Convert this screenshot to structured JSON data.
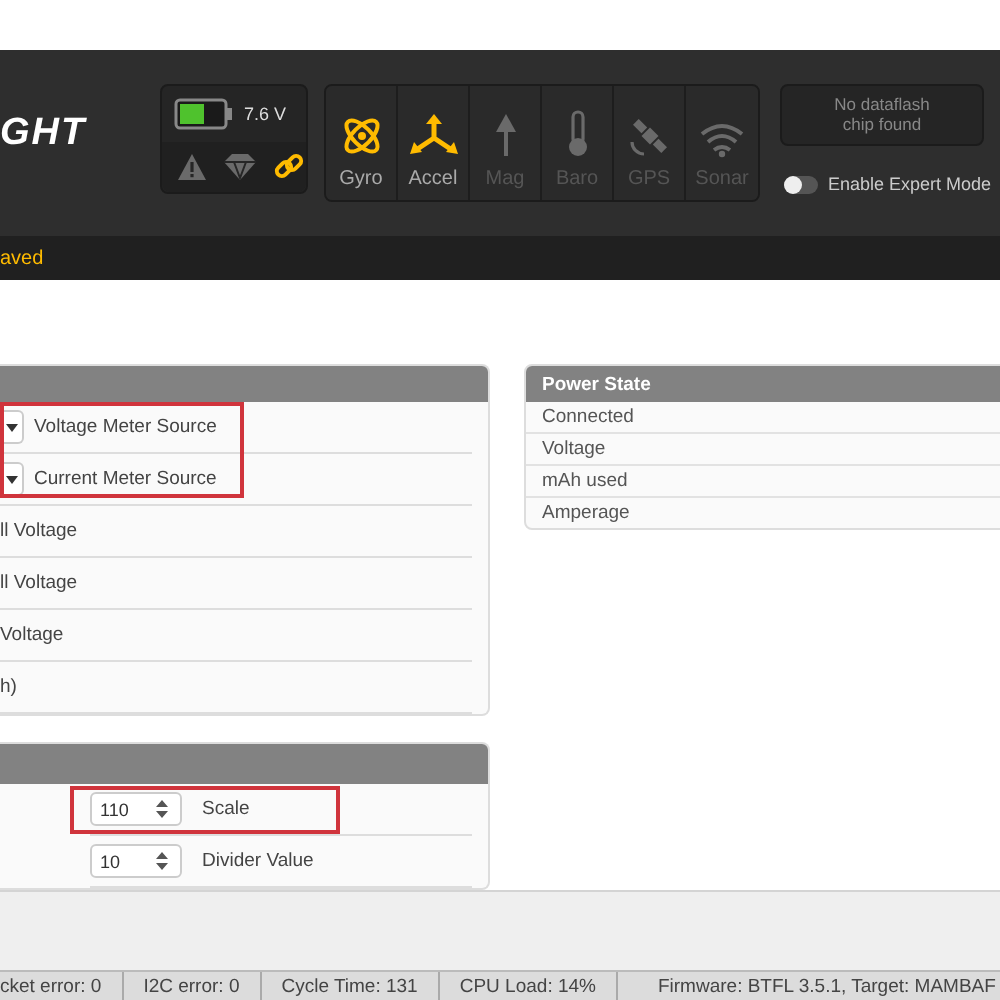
{
  "header": {
    "logo": "GHT",
    "battery": {
      "reading": "7.6 V"
    },
    "indicators": [
      {
        "kind": "warning",
        "on": false
      },
      {
        "kind": "failsafe",
        "on": false
      },
      {
        "kind": "link",
        "on": true
      }
    ],
    "sensors": [
      {
        "kind": "gyro",
        "label": "Gyro",
        "on": true
      },
      {
        "kind": "accel",
        "label": "Accel",
        "on": true
      },
      {
        "kind": "mag",
        "label": "Mag",
        "on": false
      },
      {
        "kind": "baro",
        "label": "Baro",
        "on": false
      },
      {
        "kind": "gps",
        "label": "GPS",
        "on": false
      },
      {
        "kind": "sonar",
        "label": "Sonar",
        "on": false
      }
    ],
    "dataflash_button": "No dataflash chip found",
    "expert_mode": {
      "label": "Enable Expert Mode",
      "on": false
    }
  },
  "notice": "aved",
  "left_panels": [
    {
      "groups": [
        {
          "highlighted": true,
          "rows": [
            {
              "kind": "select",
              "label": "Voltage Meter Source"
            },
            {
              "kind": "select",
              "label": "Current Meter Source"
            }
          ]
        },
        {
          "highlighted": false,
          "rows": [
            {
              "kind": "text",
              "label": "ll Voltage"
            },
            {
              "kind": "text",
              "label": "ll Voltage"
            },
            {
              "kind": "text",
              "label": "Voltage"
            },
            {
              "kind": "text",
              "label": "h)"
            }
          ]
        }
      ]
    },
    {
      "groups": [
        {
          "highlighted": true,
          "rows": [
            {
              "kind": "number",
              "value": "110",
              "label": "Scale"
            }
          ]
        },
        {
          "highlighted": false,
          "rows": [
            {
              "kind": "number",
              "value": "10",
              "label": "Divider Value"
            }
          ]
        }
      ]
    }
  ],
  "power_state": {
    "title": "Power State",
    "rows": [
      "Connected",
      "Voltage",
      "mAh used",
      "Amperage"
    ]
  },
  "status_bar": [
    "cket error: 0",
    "I2C error: 0",
    "Cycle Time: 131",
    "CPU Load: 14%",
    "Firmware: BTFL 3.5.1, Target: MAMBAF"
  ]
}
